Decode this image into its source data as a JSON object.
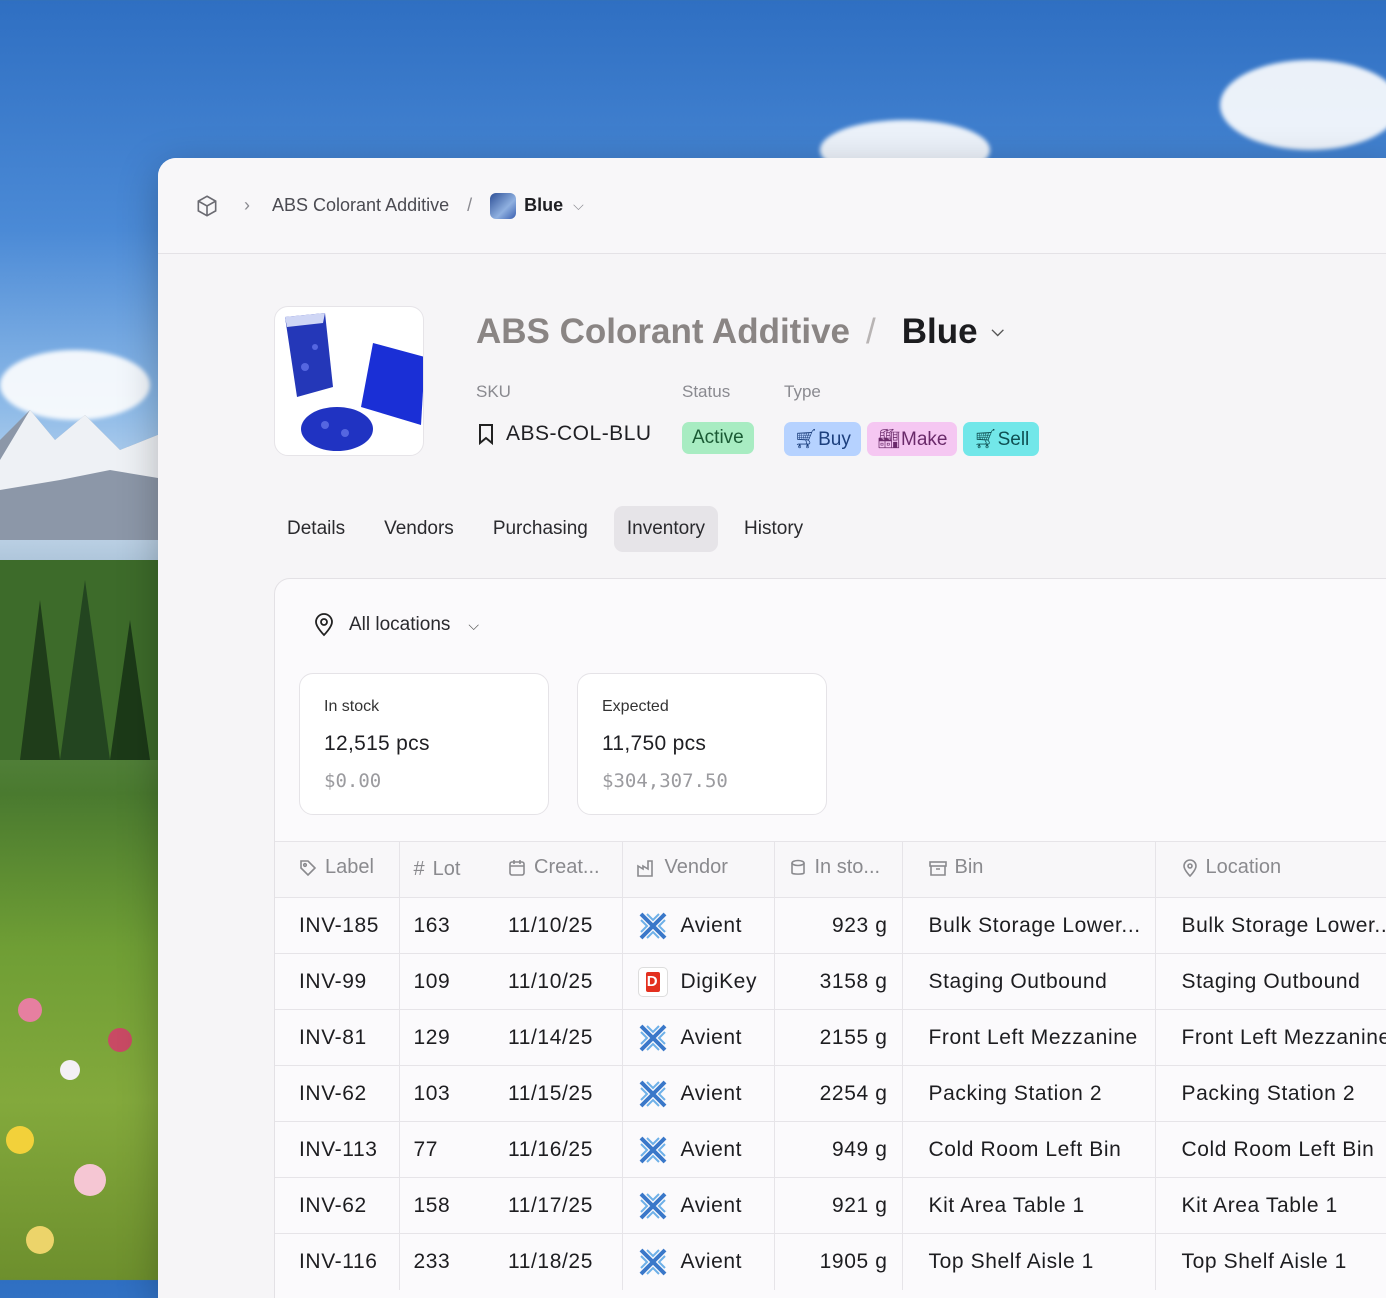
{
  "breadcrumb": {
    "parent": "ABS Colorant Additive",
    "separator": "/",
    "current": "Blue"
  },
  "product": {
    "parent_name": "ABS Colorant Additive",
    "name": "Blue",
    "sku_label": "SKU",
    "sku": "ABS-COL-BLU",
    "status_label": "Status",
    "status": "Active",
    "type_label": "Type",
    "types": [
      "Buy",
      "Make",
      "Sell"
    ]
  },
  "tabs": [
    "Details",
    "Vendors",
    "Purchasing",
    "Inventory",
    "History"
  ],
  "selected_tab": "Inventory",
  "location_filter": "All locations",
  "summary": {
    "in_stock": {
      "label": "In stock",
      "qty": "12,515 pcs",
      "value": "$0.00"
    },
    "expected": {
      "label": "Expected",
      "qty": "11,750 pcs",
      "value": "$304,307.50"
    }
  },
  "table": {
    "headers": [
      "Label",
      "Lot",
      "Creat...",
      "Vendor",
      "In sto...",
      "Bin",
      "Location"
    ],
    "rows": [
      {
        "label": "INV-185",
        "lot": "163",
        "created": "11/10/25",
        "vendor": "Avient",
        "in_stock": "923 g",
        "bin": "Bulk Storage Lower...",
        "location": "Bulk Storage Lower..."
      },
      {
        "label": "INV-99",
        "lot": "109",
        "created": "11/10/25",
        "vendor": "DigiKey",
        "in_stock": "3158 g",
        "bin": "Staging Outbound",
        "location": "Staging Outbound"
      },
      {
        "label": "INV-81",
        "lot": "129",
        "created": "11/14/25",
        "vendor": "Avient",
        "in_stock": "2155 g",
        "bin": "Front Left Mezzanine",
        "location": "Front Left Mezzanine"
      },
      {
        "label": "INV-62",
        "lot": "103",
        "created": "11/15/25",
        "vendor": "Avient",
        "in_stock": "2254 g",
        "bin": "Packing Station 2",
        "location": "Packing Station 2"
      },
      {
        "label": "INV-113",
        "lot": "77",
        "created": "11/16/25",
        "vendor": "Avient",
        "in_stock": "949 g",
        "bin": "Cold Room Left Bin",
        "location": "Cold Room Left Bin"
      },
      {
        "label": "INV-62",
        "lot": "158",
        "created": "11/17/25",
        "vendor": "Avient",
        "in_stock": "921 g",
        "bin": "Kit Area Table 1",
        "location": "Kit Area Table 1"
      },
      {
        "label": "INV-116",
        "lot": "233",
        "created": "11/18/25",
        "vendor": "Avient",
        "in_stock": "1905 g",
        "bin": "Top Shelf Aisle 1",
        "location": "Top Shelf Aisle 1"
      }
    ]
  },
  "colors": {
    "active": "#a8ecc2",
    "buy": "#b6d2ff",
    "make": "#f5c7f2",
    "sell": "#72e7e9",
    "digikey": "#e3301f",
    "avient": "#3a78c9"
  }
}
